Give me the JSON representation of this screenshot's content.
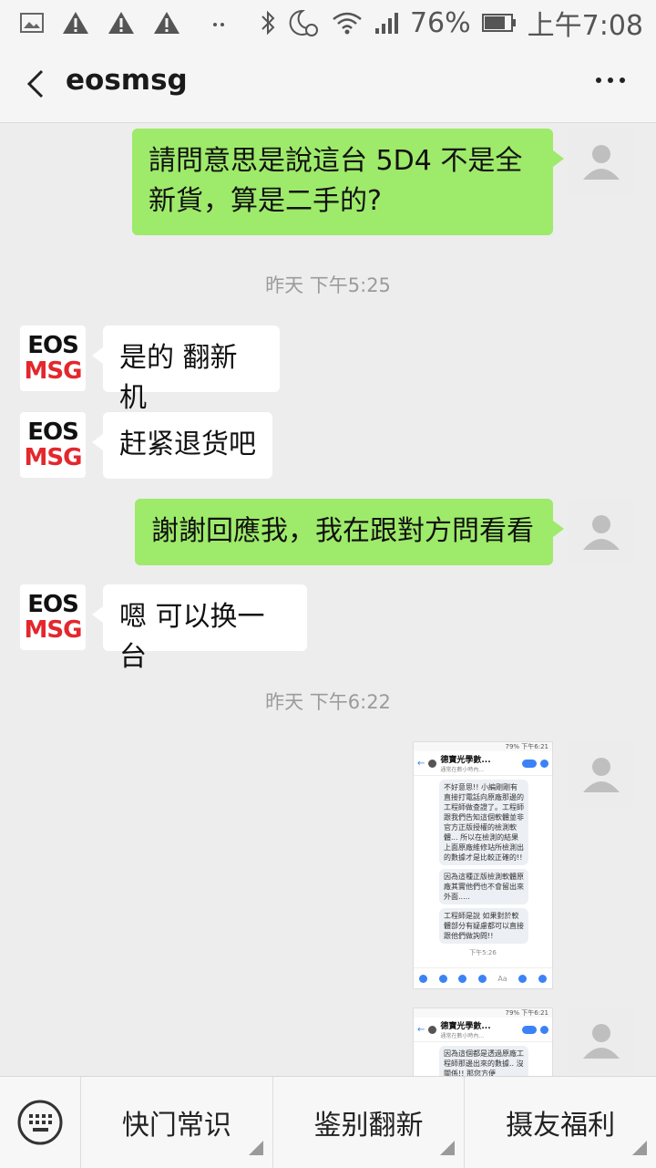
{
  "status_bar": {
    "battery": "76%",
    "time": "上午7:08",
    "icons": [
      "image-icon",
      "warning-icon",
      "warning-icon",
      "warning-icon",
      "dots-icon",
      "bluetooth-icon",
      "alarm-moon-icon",
      "wifi-icon",
      "signal-icon",
      "battery-icon"
    ]
  },
  "header": {
    "title": "eosmsg",
    "back_icon": "chevron-left-icon",
    "more_icon": "more-dots-icon"
  },
  "messages": [
    {
      "side": "right",
      "text": "請問意思是說這台 5D4 不是全新貨，算是二手的?"
    },
    {
      "timestamp": "昨天 下午5:25"
    },
    {
      "side": "left",
      "avatar_line1": "EOS",
      "avatar_line2": "MSG",
      "text": "是的 翻新机"
    },
    {
      "side": "left",
      "avatar_line1": "EOS",
      "avatar_line2": "MSG",
      "text": "赶紧退货吧"
    },
    {
      "side": "right",
      "text": "謝謝回應我，我在跟對方問看看"
    },
    {
      "side": "left",
      "avatar_line1": "EOS",
      "avatar_line2": "MSG",
      "text": "嗯 可以换一台"
    },
    {
      "timestamp": "昨天 下午6:22"
    }
  ],
  "screenshot1": {
    "status": "79% 下午6:21",
    "name": "德寶光學數...",
    "subtitle": "通常在數小時內...",
    "msgs": [
      "不好意思!! 小編剛剛有直接打電話向原廠那邊的工程師做查證了。工程師跟我們告知這個軟體並非官方正版授權的檢測軟體... 所以在檢測的結果上面原廠維修站所檢測出的數據才是比較正確的!!",
      "因為這種正版檢測軟體原廠其實他們也不會留出來外面.....",
      "工程師是說 如果對於軟體部分有疑慮都可以直接跟他們做詢問!!"
    ],
    "time": "下午5:26",
    "input_placeholder": "Aa"
  },
  "screenshot2": {
    "status": "79% 下午6:21",
    "name": "德寶光學數...",
    "subtitle": "通常在數小時內...",
    "msg": "因為這個都是透過原廠工程師那邊出來的數據.. 沒關係!! 那您方便"
  },
  "bottom_menu": {
    "keyboard_icon": "keyboard-icon",
    "items": [
      "快门常识",
      "鉴别翻新",
      "摄友福利"
    ]
  }
}
